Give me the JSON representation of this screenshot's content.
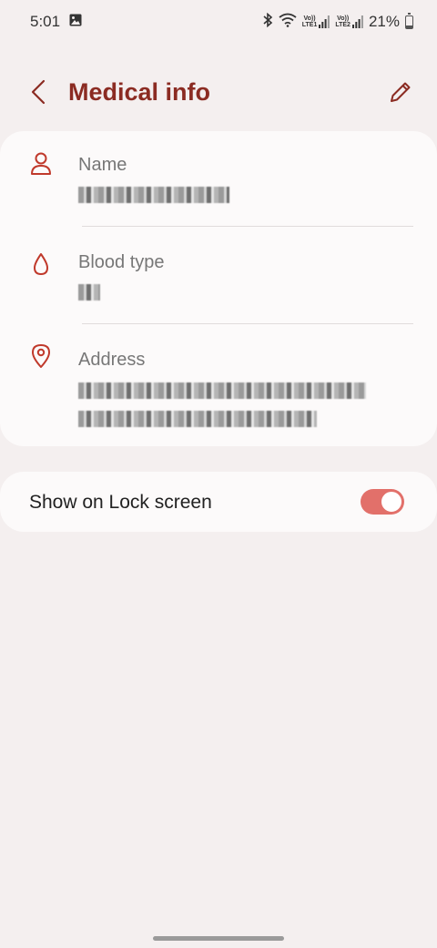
{
  "status_bar": {
    "time": "5:01",
    "gallery_icon": "image-icon",
    "bluetooth_icon": "bluetooth-icon",
    "wifi_icon": "wifi-icon",
    "sim1_label_top": "Vo))",
    "sim1_label_bottom": "LTE1",
    "sim2_label_top": "Vo))",
    "sim2_label_bottom": "LTE2",
    "battery_percent": "21%"
  },
  "header": {
    "title": "Medical info",
    "back_icon": "chevron-left-icon",
    "edit_icon": "pencil-icon"
  },
  "info_card": {
    "rows": [
      {
        "label": "Name",
        "icon": "person-icon"
      },
      {
        "label": "Blood type",
        "icon": "droplet-icon"
      },
      {
        "label": "Address",
        "icon": "location-pin-icon"
      }
    ]
  },
  "lock_screen": {
    "label": "Show on Lock screen",
    "enabled": true
  },
  "colors": {
    "accent": "#8b2b22",
    "icon_red": "#c0392b",
    "toggle_on": "#e2706a",
    "background": "#f4efef",
    "card": "#fcfafa"
  }
}
